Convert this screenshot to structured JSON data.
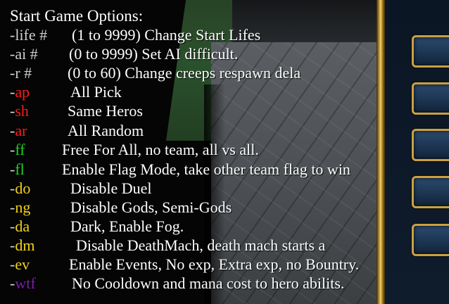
{
  "title": "Start Game Options:",
  "colors": {
    "grey": "#cfcfcf",
    "red": "#ff1a1a",
    "green": "#22d42a",
    "yellow": "#f2d21a",
    "purple": "#7a1fa8",
    "text": "#ffffff",
    "frame_gold": "#caa040",
    "button_blue": "#1c3552"
  },
  "options": [
    {
      "dash": "-",
      "code": "life #",
      "color": "grey",
      "desc": "(1 to 9999) Change Start Lifes"
    },
    {
      "dash": "-",
      "code": "ai #",
      "color": "grey",
      "desc": "(0 to 9999) Set AI difficult."
    },
    {
      "dash": "-",
      "code": "r #",
      "color": "grey",
      "desc": "(0 to 60) Change creeps respawn dela"
    },
    {
      "dash": "-",
      "code": "ap",
      "color": "red",
      "desc": "All Pick"
    },
    {
      "dash": "-",
      "code": "sh",
      "color": "red",
      "desc": "Same Heros"
    },
    {
      "dash": "-",
      "code": "ar",
      "color": "red",
      "desc": "All Random"
    },
    {
      "dash": "-",
      "code": "ff",
      "color": "green",
      "desc": "Free For All, no team, all vs all."
    },
    {
      "dash": "-",
      "code": "fl",
      "color": "green",
      "desc": "Enable Flag Mode, take other team flag to win"
    },
    {
      "dash": "-",
      "code": "do",
      "color": "yellow",
      "desc": "Disable Duel"
    },
    {
      "dash": "-",
      "code": "ng",
      "color": "yellow",
      "desc": "Disable Gods, Semi-Gods"
    },
    {
      "dash": "-",
      "code": "da",
      "color": "yellow",
      "desc": "Dark, Enable Fog."
    },
    {
      "dash": "-",
      "code": "dm",
      "color": "yellow",
      "desc": "Disable DeathMach, death mach starts a"
    },
    {
      "dash": "-",
      "code": "ev",
      "color": "yellow",
      "desc": "Enable Events, No exp, Extra exp, no Bountry."
    },
    {
      "dash": "-",
      "code": "wtf",
      "color": "purple",
      "desc": "No Cooldown and mana cost to hero abilits."
    }
  ],
  "side_buttons": [
    "command-button-1",
    "command-button-2",
    "command-button-3",
    "command-button-4",
    "command-button-5"
  ]
}
